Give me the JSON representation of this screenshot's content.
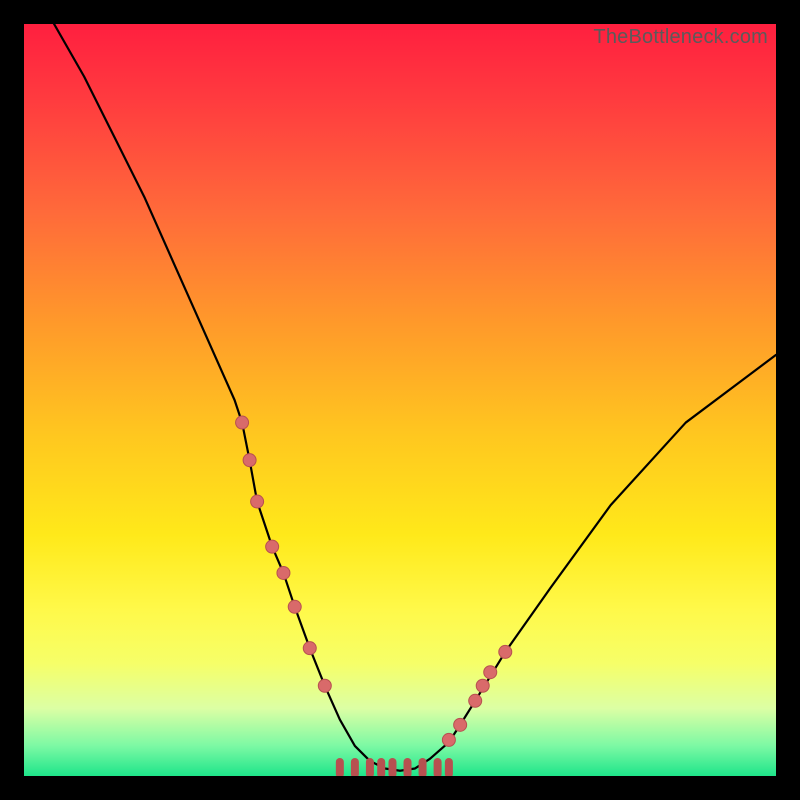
{
  "attribution": "TheBottleneck.com",
  "colors": {
    "frame": "#000000",
    "curve": "#000000",
    "marker_fill": "#d96a6a",
    "marker_stroke": "#b75050",
    "tick_stroke": "#b75050",
    "gradient_top": "#ff1f3f",
    "gradient_bottom": "#1ee58a"
  },
  "chart_data": {
    "type": "line",
    "title": "",
    "xlabel": "",
    "ylabel": "",
    "xlim": [
      0,
      100
    ],
    "ylim": [
      0,
      100
    ],
    "series": [
      {
        "name": "bottleneck-curve",
        "x": [
          4,
          8,
          12,
          16,
          20,
          24,
          28,
          29,
          30,
          31,
          33,
          34.5,
          36,
          38,
          40,
          42,
          44,
          46,
          48,
          50,
          52,
          54,
          56.5,
          58,
          60,
          64,
          70,
          78,
          88,
          100
        ],
        "y": [
          100,
          93,
          85,
          77,
          68,
          59,
          50,
          47,
          42,
          36.5,
          30.5,
          27,
          22.5,
          17,
          12,
          7.5,
          4,
          2,
          1,
          0.7,
          1,
          2.3,
          4.5,
          6.8,
          10,
          16.5,
          25,
          36,
          47,
          56
        ]
      }
    ],
    "markers_left": [
      {
        "x": 29,
        "y": 47
      },
      {
        "x": 30,
        "y": 42
      },
      {
        "x": 31,
        "y": 36.5
      },
      {
        "x": 33,
        "y": 30.5
      },
      {
        "x": 34.5,
        "y": 27
      },
      {
        "x": 36,
        "y": 22.5
      },
      {
        "x": 38,
        "y": 17
      },
      {
        "x": 40,
        "y": 12
      }
    ],
    "markers_right": [
      {
        "x": 56.5,
        "y": 4.8
      },
      {
        "x": 58,
        "y": 6.8
      },
      {
        "x": 60,
        "y": 10
      },
      {
        "x": 61,
        "y": 12
      },
      {
        "x": 62,
        "y": 13.8
      },
      {
        "x": 64,
        "y": 16.5
      }
    ],
    "bottom_ticks": [
      42,
      44,
      46,
      47.5,
      49,
      51,
      53,
      55,
      56.5
    ],
    "annotations": []
  }
}
